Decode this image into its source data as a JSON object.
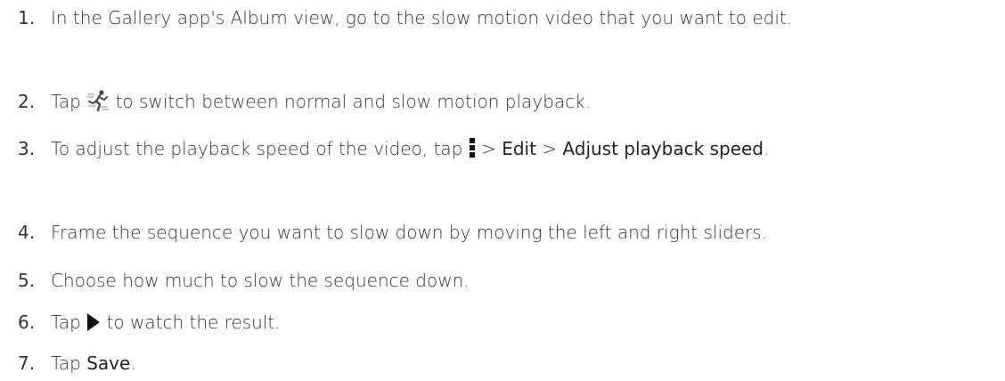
{
  "steps": [
    {
      "number": "1.",
      "text": "In the Gallery app's Album view, go to the slow motion video that you want to edit."
    },
    {
      "number": "2.",
      "before": "Tap",
      "icon": "slow-motion-runner-icon",
      "after": "to switch between normal and slow motion playback."
    },
    {
      "number": "3.",
      "before": "To adjust the playback speed of the video, tap",
      "icon": "menu-dots-icon",
      "sep1": ">",
      "edit": "Edit",
      "sep2": ">",
      "adjust": "Adjust playback speed",
      "end": "."
    },
    {
      "number": "4.",
      "text": "Frame the sequence you want to slow down by moving the left and right sliders."
    },
    {
      "number": "5.",
      "text": "Choose how much to slow the sequence down."
    },
    {
      "number": "6.",
      "before": "Tap",
      "icon": "play-icon",
      "after": "to watch the result."
    },
    {
      "number": "7.",
      "before": "Tap",
      "save": "Save",
      "end": "."
    }
  ]
}
